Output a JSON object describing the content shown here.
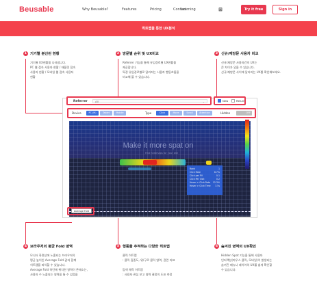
{
  "header": {
    "logo": "Beusable",
    "menu": [
      "Why Beusable?",
      "Features",
      "Pricing",
      "Contact",
      "Learning"
    ],
    "lang_icon": "korean-flag-icon",
    "try_label": "Try it free",
    "signin_label": "Sign in"
  },
  "banner": {
    "title": "히트맵을 통한 UX분석"
  },
  "features_top": [
    {
      "num": "1",
      "title": "기기별 분산된 현황",
      "lines": [
        "기기별 UX현황을 나타냅니다.",
        "PC 웹 접속 사용자 현황 / 태블릿 접속",
        "사용자 현황 / 모바일 웹 접속 사용자",
        "현황"
      ]
    },
    {
      "num": "2",
      "title": "방문별 순위 및 UX비교",
      "lines": [
        "Referrer 기능을 통해 유입경로별 UX현황을",
        "제공합니다.",
        "특정 유입경로별로 달라지는 사용자 행동흐름을",
        "비교해 볼 수 있습니다."
      ]
    },
    {
      "num": "3",
      "title": "신규/재방문 사용자 비교",
      "lines": [
        "신규/재방문 사용자간의 UX는",
        "큰 차이가 있을 수 있습니다.",
        "신규/재방문 사이에 달라지는 UX를 확인해보세요."
      ]
    }
  ],
  "features_bottom": [
    {
      "num": "4",
      "title": "브라우저의 평균 Fold 영역",
      "lines": [
        "모니터 화면상에 노출되는 브라우저의",
        "평균 높이인 Average Fold 값과 함께",
        "히트맵을 파악할 수 있습니다.",
        "Average Fold 하단에 위치한 영역이 존재소는,",
        "사용자 수 노출되는 영역을 통 수 있음을"
      ]
    },
    {
      "num": "5",
      "title": "행동을 추적하는 다양한 히트맵",
      "lines": [
        "클릭 히트맵",
        ": 클릭 집중도, 위/구로 클릭 영역, 관련 지표",
        "",
        "탐색 체적 히트맵",
        ": 사용자 관심 보고 영역 결정의 도표 측정"
      ]
    },
    {
      "num": "6",
      "title": "숨겨진 영역의 UX확인",
      "lines": [
        "Hidden Spot 기능을 통해 사용자",
        "인터랙션(마우스 클릭, 모바일)이 발생되는",
        "숨겨진 메뉴나 레이어의 UX를 쉽게 확인할",
        "수 있습니다."
      ]
    }
  ],
  "mock": {
    "referrer_label": "Referrer",
    "referrer_value": "All",
    "new_label": "New",
    "return_label": "Return",
    "device_label": "Device",
    "device_options": [
      "PC (M)",
      "Tablet",
      "Mobile"
    ],
    "type_label": "Type",
    "type_options": [
      "Click",
      "Move",
      "Scroll",
      "Attention"
    ],
    "hidden_label": "Hidden",
    "hidden_toggle": "OFF",
    "headline": "Make it more spat on",
    "subline": "Find heatmaps for your site",
    "tooltip": [
      [
        "Rank",
        "1"
      ],
      [
        "Click Rate",
        "8.7%"
      ],
      [
        "Click per PV",
        "0.1"
      ],
      [
        "Click Per Visit",
        "0.2"
      ],
      [
        "Hover > Click Rate",
        "12.3%"
      ],
      [
        "Hover > Click Time",
        "3.5s"
      ]
    ],
    "fold_label": "Average Fold"
  },
  "colors": {
    "accent": "#e8384f",
    "banner": "#f4424c",
    "blue": "#3b6fe0",
    "heat_bg": "#1e2440"
  }
}
